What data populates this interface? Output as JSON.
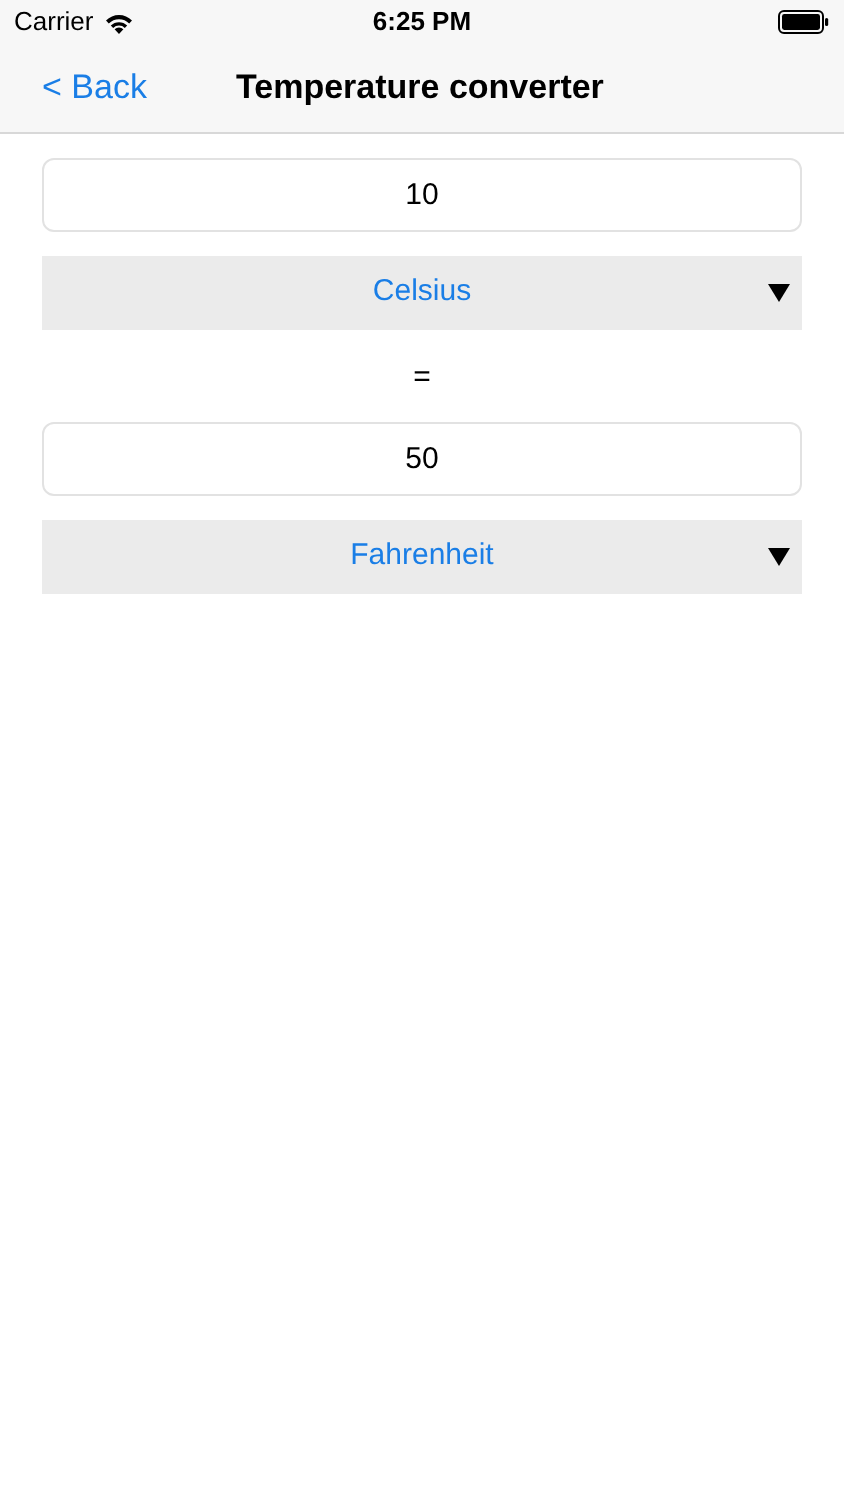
{
  "status_bar": {
    "carrier": "Carrier",
    "time": "6:25 PM"
  },
  "nav_bar": {
    "back": "< Back",
    "title": "Temperature converter"
  },
  "input": {
    "value": "10"
  },
  "from_unit": {
    "label": "Celsius"
  },
  "equals": "=",
  "output": {
    "value": "50"
  },
  "to_unit": {
    "label": "Fahrenheit"
  }
}
